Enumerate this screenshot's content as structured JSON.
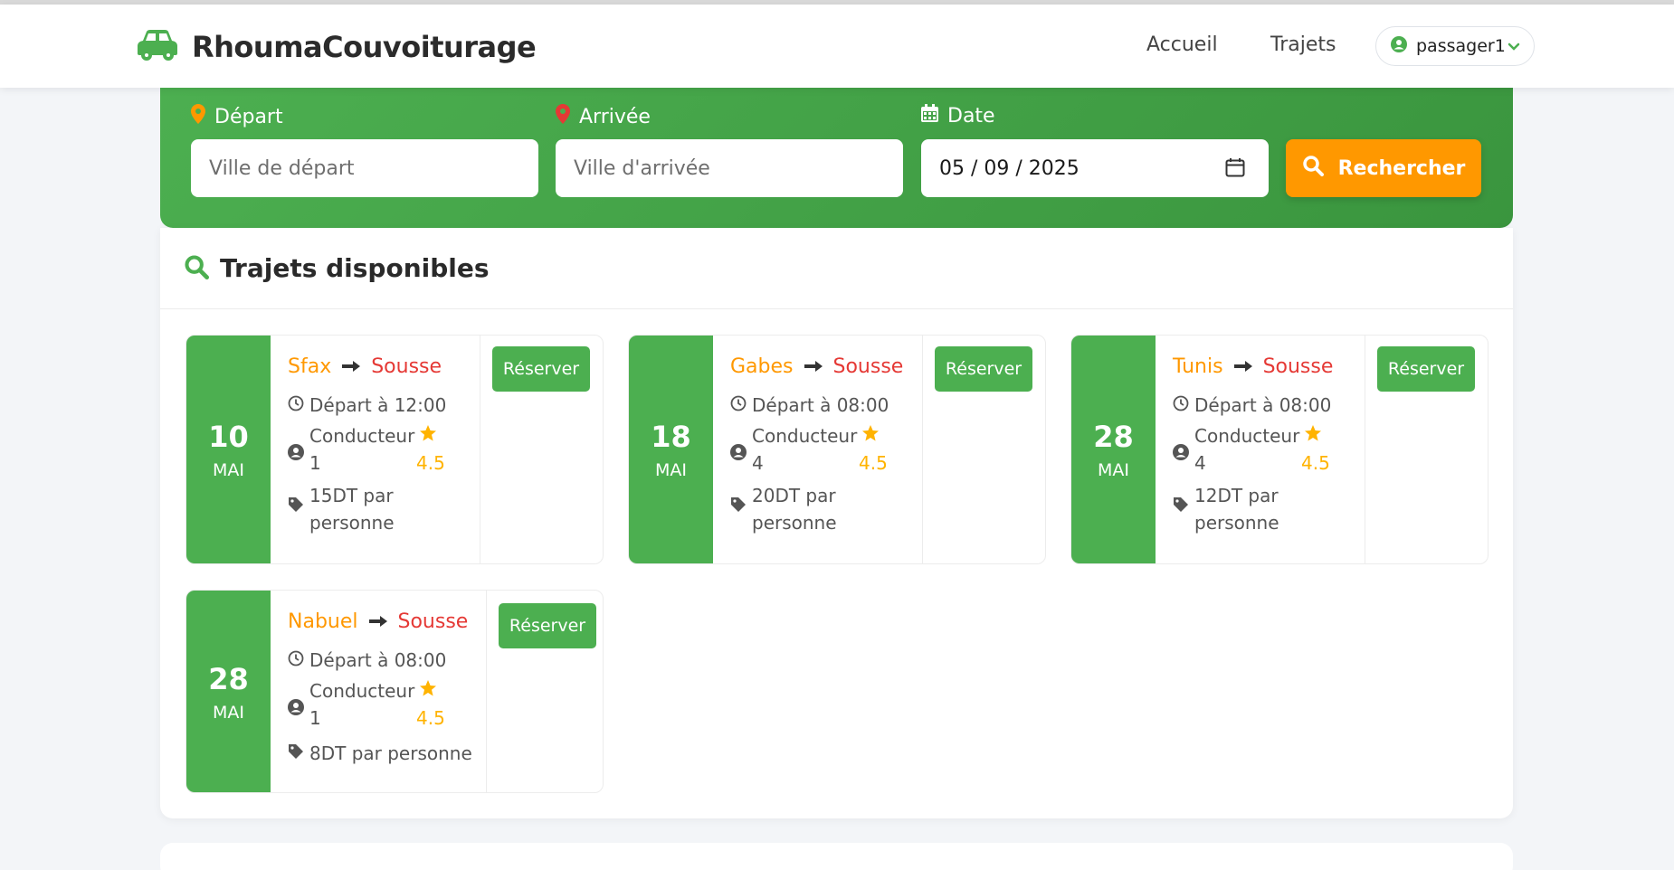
{
  "brand": {
    "name": "RhoumaCouvoiturage",
    "color": "#4caf50"
  },
  "nav": {
    "home": "Accueil",
    "trips": "Trajets",
    "user": "passager1"
  },
  "search": {
    "depart_label": "Départ",
    "depart_placeholder": "Ville de départ",
    "arrivee_label": "Arrivée",
    "arrivee_placeholder": "Ville d'arrivée",
    "date_label": "Date",
    "date_value": "05 / 09 / 2025",
    "button_label": "Rechercher"
  },
  "results": {
    "title": "Trajets disponibles",
    "trips": [
      {
        "day": "10",
        "month": "MAI",
        "from": "Sfax",
        "to": "Sousse",
        "departure": "Départ à 12:00",
        "driver_line1": "Conducteur",
        "driver_line2": "1",
        "rating": "4.5",
        "price": "15DT par personne",
        "button": "Réserver"
      },
      {
        "day": "18",
        "month": "MAI",
        "from": "Gabes",
        "to": "Sousse",
        "departure": "Départ à 08:00",
        "driver_line1": "Conducteur",
        "driver_line2": "4",
        "rating": "4.5",
        "price": "20DT par personne",
        "button": "Réserver"
      },
      {
        "day": "28",
        "month": "MAI",
        "from": "Tunis",
        "to": "Sousse",
        "departure": "Départ à 08:00",
        "driver_line1": "Conducteur",
        "driver_line2": "4",
        "rating": "4.5",
        "price": "12DT par personne",
        "button": "Réserver"
      },
      {
        "day": "28",
        "month": "MAI",
        "from": "Nabuel",
        "to": "Sousse",
        "departure": "Départ à 08:00",
        "driver_line1": "Conducteur",
        "driver_line2": "1",
        "rating": "4.5",
        "price": "8DT par personne",
        "button": "Réserver"
      }
    ]
  },
  "colors": {
    "primary": "#4caf50",
    "accent": "#ff9800",
    "danger": "#e53935",
    "star": "#ffb300"
  },
  "icons": [
    "car-icon",
    "user-circle-icon",
    "chevron-down-icon",
    "map-marker-icon",
    "calendar-icon",
    "search-icon",
    "clock-icon",
    "tag-icon",
    "star-icon",
    "arrow-right-icon"
  ]
}
